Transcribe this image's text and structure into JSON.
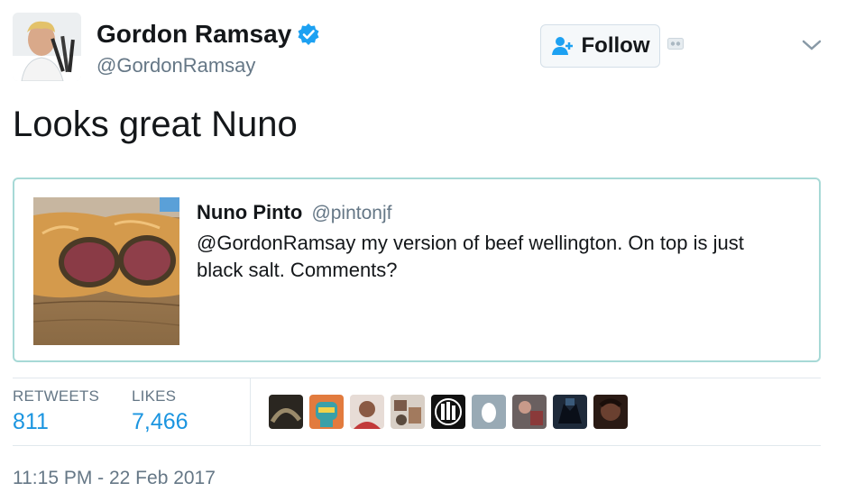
{
  "header": {
    "display_name": "Gordon Ramsay",
    "handle": "@GordonRamsay",
    "follow_label": "Follow"
  },
  "tweet": {
    "text": "Looks great Nuno"
  },
  "quoted_tweet": {
    "author_name": "Nuno Pinto",
    "author_handle": "@pintonjf",
    "text": "@GordonRamsay my version of beef wellington. On top is just black salt. Comments?"
  },
  "stats": {
    "retweets_label": "RETWEETS",
    "retweets_count": "811",
    "likes_label": "LIKES",
    "likes_count": "7,466"
  },
  "timestamp": "11:15 PM - 22 Feb 2017",
  "colors": {
    "link_blue": "#1b95e0",
    "verified_blue": "#1da1f2",
    "quote_border": "#a7d9d6",
    "secondary_text": "#657786"
  },
  "icons": {
    "verified": "verified-badge-icon",
    "follow": "add-user-icon",
    "menu": "chevron-down-icon"
  }
}
